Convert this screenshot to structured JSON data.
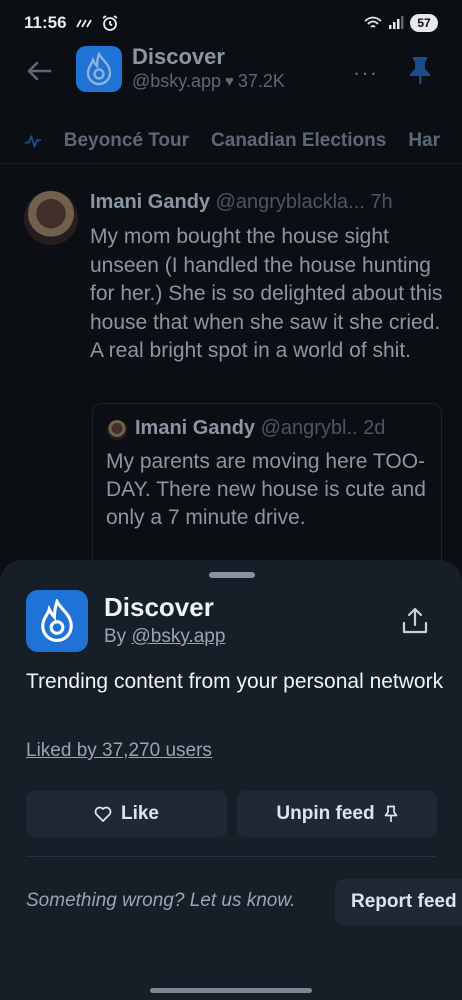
{
  "status_bar": {
    "time": "11:56",
    "battery": "57",
    "icons": [
      "data-saver-icon",
      "alarm-icon",
      "wifi-icon",
      "signal-icon"
    ]
  },
  "feed_header": {
    "title": "Discover",
    "handle": "@bsky.app",
    "likes": "37.2K",
    "more": "···"
  },
  "trending": {
    "items": [
      "Beyoncé Tour",
      "Canadian Elections",
      "Har"
    ]
  },
  "post": {
    "author_name": "Imani Gandy",
    "author_handle": "@angryblackla...",
    "time": "7h",
    "text": "My mom bought the house sight unseen (I handled the house hunting for her.) She is so delighted about this house that when she saw it she cried. A real bright spot in a world of shit.",
    "quote": {
      "author_name": "Imani Gandy",
      "author_handle": "@angrybl..",
      "time": "2d",
      "text": "My parents are moving here TOO-DAY. There new house is cute and only a 7 minute drive."
    }
  },
  "sheet": {
    "title": "Discover",
    "by_prefix": "By",
    "by_handle": "@bsky.app",
    "description": "Trending content from your personal network",
    "liked_by": "Liked by 37,270 users",
    "like_label": "Like",
    "unpin_label": "Unpin feed",
    "report_prompt": "Something wrong? Let us know.",
    "report_label": "Report feed"
  },
  "colors": {
    "accent": "#1f73d6",
    "sheet_bg": "#161e27",
    "button_bg": "#1f2935"
  }
}
